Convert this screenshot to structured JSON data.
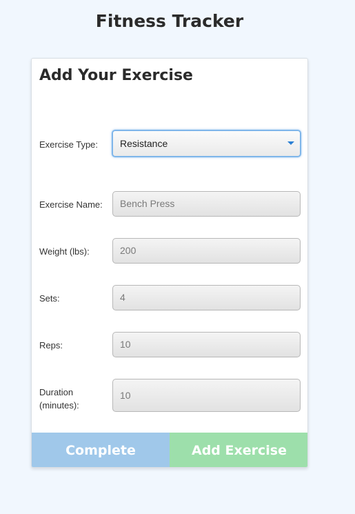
{
  "app": {
    "title": "Fitness Tracker"
  },
  "form": {
    "title": "Add Your Exercise",
    "exercise_type": {
      "label": "Exercise Type:",
      "value": "Resistance"
    },
    "exercise_name": {
      "label": "Exercise Name:",
      "placeholder": "Bench Press"
    },
    "weight": {
      "label": "Weight (lbs):",
      "placeholder": "200"
    },
    "sets": {
      "label": "Sets:",
      "placeholder": "4"
    },
    "reps": {
      "label": "Reps:",
      "placeholder": "10"
    },
    "duration": {
      "label_line1": "Duration",
      "label_line2": "(minutes):",
      "placeholder": "10"
    }
  },
  "buttons": {
    "complete": "Complete",
    "add_exercise": "Add Exercise"
  },
  "colors": {
    "complete_button": "#a0c8ea",
    "add_button": "#9ddfab",
    "background": "#f1f7fe"
  },
  "icons": {
    "select_caret": "chevron-down-icon"
  }
}
